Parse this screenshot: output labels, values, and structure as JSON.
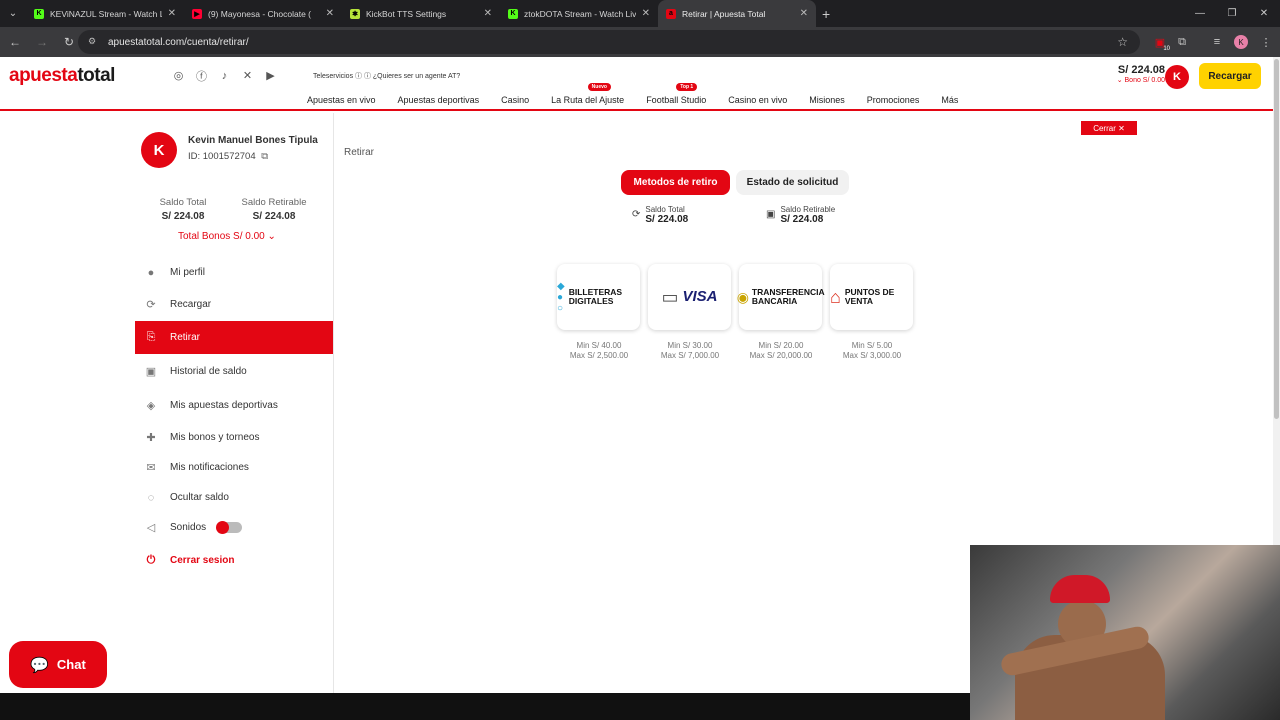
{
  "browser": {
    "tabs": [
      {
        "title": "KEViNAZUL Stream - Watch Live",
        "fav": "K",
        "color": "#53fc18"
      },
      {
        "title": "(9) Mayonesa - Chocolate (",
        "fav": "▶",
        "color": "#ff0033"
      },
      {
        "title": "KickBot TTS Settings",
        "fav": "✱",
        "color": "#b6e33a"
      },
      {
        "title": "ztokDOTA Stream - Watch Live",
        "fav": "K",
        "color": "#53fc18"
      },
      {
        "title": "Retirar | Apuesta Total",
        "fav": "a",
        "color": "#e30613"
      }
    ],
    "url": "apuestatotal.com/cuenta/retirar/",
    "ext_badge": "10",
    "profile_initial": "K"
  },
  "header": {
    "logo_a": "apuesta",
    "logo_b": "total",
    "teleservicios": "Teleservicios ⓘ ⓘ  ¿Quieres ser un agente AT?",
    "nav": [
      {
        "label": "Apuestas en vivo",
        "badge": ""
      },
      {
        "label": "Apuestas deportivas",
        "badge": ""
      },
      {
        "label": "Casino",
        "badge": ""
      },
      {
        "label": "La Ruta del Ajuste",
        "badge": "Nuevo"
      },
      {
        "label": "Football Studio",
        "badge": "Top 1"
      },
      {
        "label": "Casino en vivo",
        "badge": ""
      },
      {
        "label": "Misiones",
        "badge": ""
      },
      {
        "label": "Promociones",
        "badge": ""
      },
      {
        "label": "Más",
        "badge": ""
      }
    ],
    "balance": "S/ 224.08",
    "bono": "⌄ Bono S/  0.00",
    "avatar": "K",
    "recargar": "Recargar"
  },
  "profile": {
    "initial": "K",
    "name": "Kevin Manuel Bones Tipula",
    "id": "ID: 1001572704",
    "saldo_total_label": "Saldo Total",
    "saldo_total": "S/ 224.08",
    "saldo_retirable_label": "Saldo Retirable",
    "saldo_retirable": "S/ 224.08",
    "total_bonos": "Total Bonos S/ 0.00 ⌄"
  },
  "menu": [
    {
      "label": "Mi perfil",
      "icon": "user-icon",
      "glyph": "●"
    },
    {
      "label": "Recargar",
      "icon": "recharge-icon",
      "glyph": "⟳"
    },
    {
      "label": "Retirar",
      "icon": "withdraw-icon",
      "glyph": "⎘"
    },
    {
      "label": "Historial de saldo",
      "icon": "wallet-icon",
      "glyph": "▣"
    },
    {
      "label": "Mis apuestas deportivas",
      "icon": "ticket-icon",
      "glyph": "◈"
    },
    {
      "label": "Mis bonos y torneos",
      "icon": "gift-icon",
      "glyph": "✚"
    },
    {
      "label": "Mis notificaciones",
      "icon": "mail-icon",
      "glyph": "✉"
    },
    {
      "label": "Ocultar saldo",
      "icon": "eye-off-icon",
      "glyph": "◌"
    },
    {
      "label": "Sonidos",
      "icon": "speaker-icon",
      "glyph": "◁"
    },
    {
      "label": "Cerrar sesion",
      "icon": "power-icon",
      "glyph": "⏻"
    }
  ],
  "main": {
    "cerrar": "Cerrar ✕",
    "breadcrumb": "Retirar",
    "tab_methods": "Metodos de retiro",
    "tab_status": "Estado de solicitud",
    "saldo_total_label": "Saldo Total",
    "saldo_total": "S/ 224.08",
    "saldo_retirable_label": "Saldo Retirable",
    "saldo_retirable": "S/ 224.08",
    "methods": [
      {
        "label": "BILLETERAS DIGITALES",
        "min": "Min S/ 40.00",
        "max": "Max S/ 2,500.00",
        "icon": "wallet-apps-icon"
      },
      {
        "label": "VISA",
        "min": "Min S/ 30.00",
        "max": "Max S/ 7,000.00",
        "icon": "visa-card-icon"
      },
      {
        "label": "TRANSFERENCIA BANCARIA",
        "min": "Min S/ 20.00",
        "max": "Max S/ 20,000.00",
        "icon": "bank-transfer-icon"
      },
      {
        "label": "PUNTOS DE VENTA",
        "min": "Min S/ 5.00",
        "max": "Max S/ 3,000.00",
        "icon": "store-icon"
      }
    ]
  },
  "chat": "Chat"
}
